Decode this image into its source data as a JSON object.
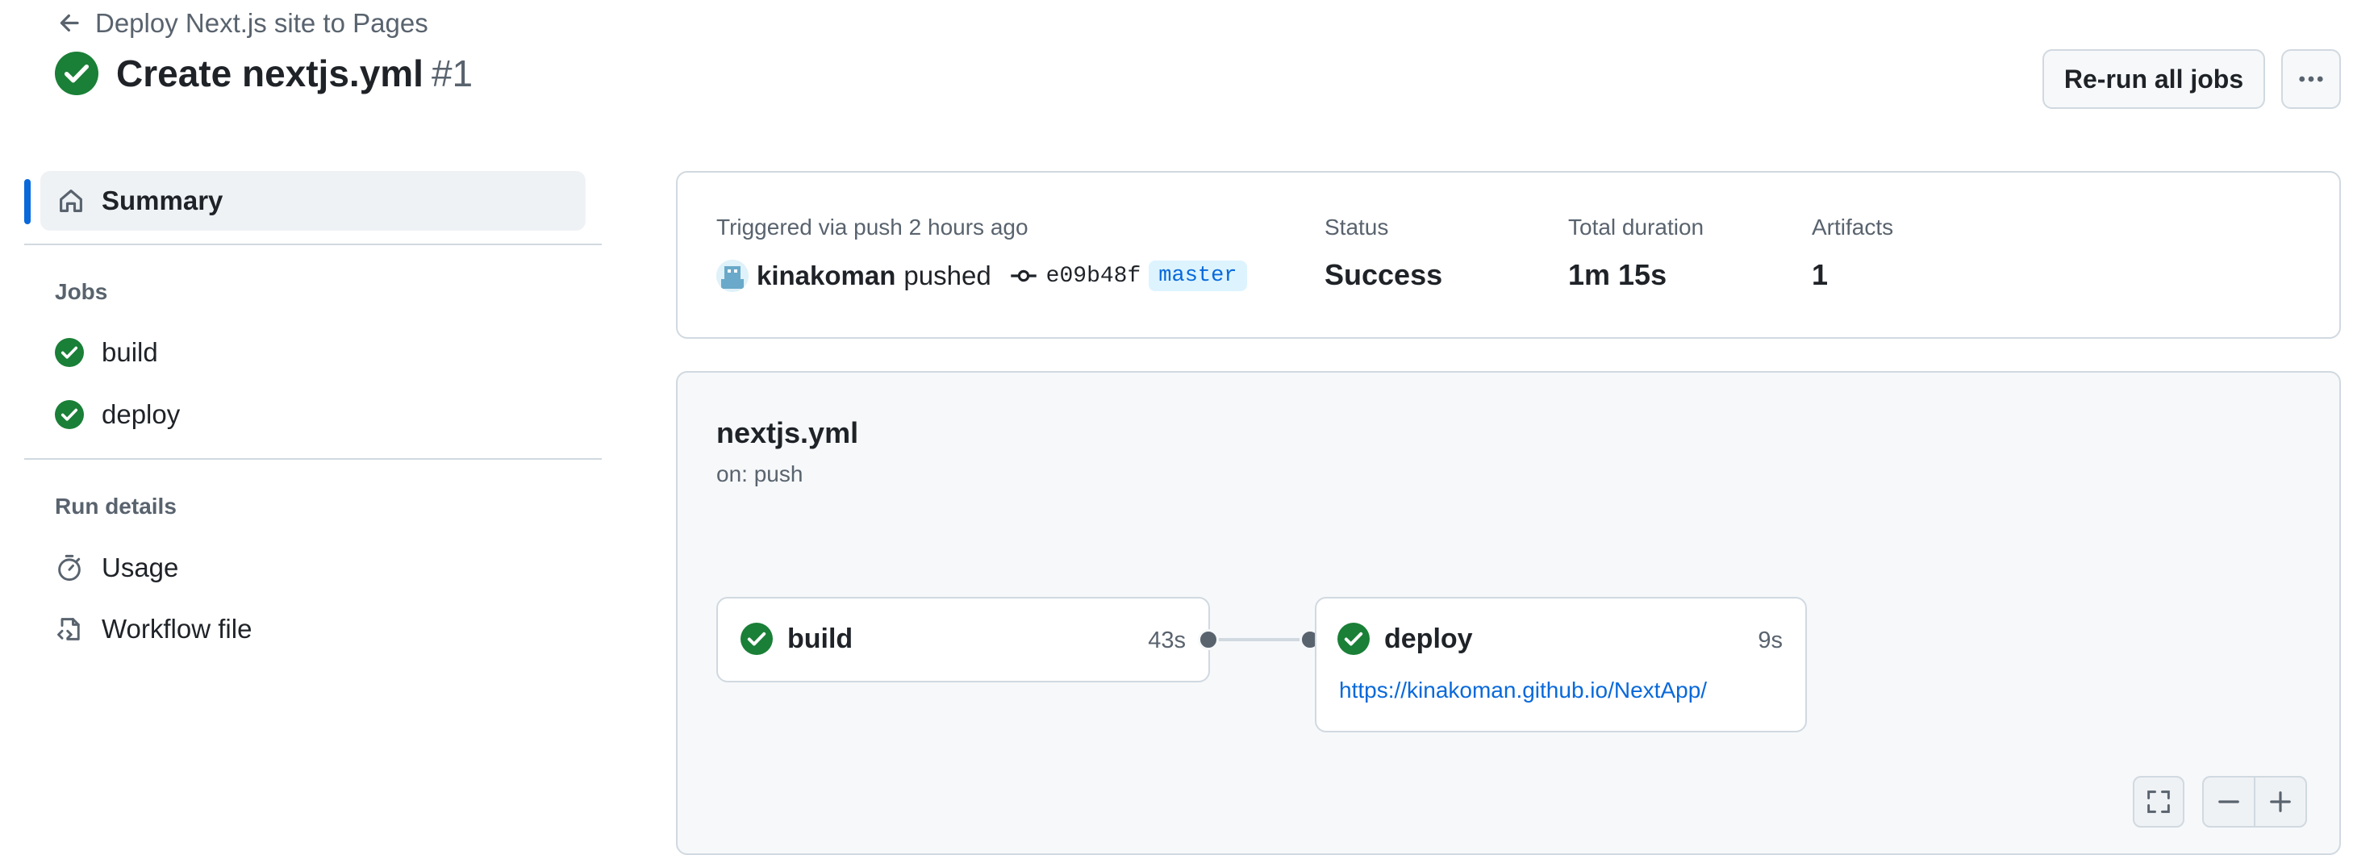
{
  "header": {
    "back_label": "Deploy Next.js site to Pages",
    "title": "Create nextjs.yml",
    "run_number": "#1",
    "rerun_label": "Re-run all jobs"
  },
  "sidebar": {
    "summary_label": "Summary",
    "jobs_heading": "Jobs",
    "jobs": [
      {
        "label": "build"
      },
      {
        "label": "deploy"
      }
    ],
    "run_details_heading": "Run details",
    "details": [
      {
        "label": "Usage",
        "icon": "stopwatch-icon"
      },
      {
        "label": "Workflow file",
        "icon": "file-code-icon"
      }
    ]
  },
  "summary": {
    "triggered_text": "Triggered via push 2 hours ago",
    "user": "kinakoman",
    "action": "pushed",
    "commit": "e09b48f",
    "branch": "master",
    "status_label": "Status",
    "status_value": "Success",
    "duration_label": "Total duration",
    "duration_value": "1m 15s",
    "artifacts_label": "Artifacts",
    "artifacts_value": "1"
  },
  "workflow": {
    "file": "nextjs.yml",
    "trigger": "on: push",
    "jobs": [
      {
        "name": "build",
        "duration": "43s"
      },
      {
        "name": "deploy",
        "duration": "9s",
        "link": "https://kinakoman.github.io/NextApp/"
      }
    ]
  },
  "colors": {
    "success": "#1a7f37",
    "accent": "#0969da",
    "border": "#d1d9e0",
    "muted": "#59636e"
  }
}
